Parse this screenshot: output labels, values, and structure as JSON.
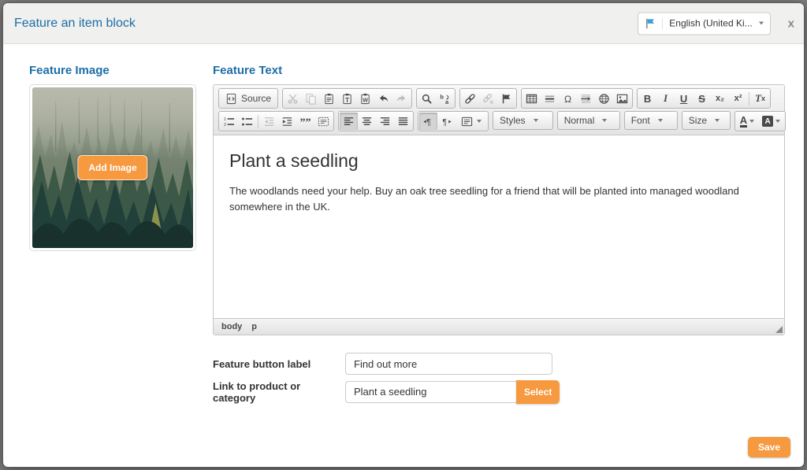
{
  "modal": {
    "title": "Feature an item block",
    "close_label": "x",
    "language": {
      "value": "English (United Ki...",
      "flag_icon": "blue-flag"
    }
  },
  "feature_image": {
    "heading": "Feature Image",
    "add_button_label": "Add Image",
    "image_description": "misty pine forest"
  },
  "feature_text": {
    "heading": "Feature Text"
  },
  "editor": {
    "toolbar": {
      "source_label": "Source",
      "styles_label": "Styles",
      "format_value": "Normal",
      "font_label": "Font",
      "size_label": "Size",
      "bold": "B",
      "italic": "I",
      "underline": "U",
      "strike": "S",
      "subscript": "x₂",
      "superscript": "x²",
      "removeformat_t": "T",
      "removeformat_x": "x",
      "text_color_letter": "A",
      "bg_color_letter": "A",
      "row1_icons": [
        "source",
        "cut",
        "copy",
        "paste",
        "paste-plain-text",
        "paste-from-word",
        "undo",
        "redo",
        "find",
        "replace",
        "link",
        "unlink",
        "anchor",
        "table",
        "horizontal-rule",
        "special-character",
        "page-break",
        "iframe",
        "image",
        "bold",
        "italic",
        "underline",
        "strikethrough",
        "subscript",
        "superscript",
        "remove-format"
      ],
      "row2_icons": [
        "numbered-list",
        "bulleted-list",
        "decrease-indent",
        "increase-indent",
        "blockquote",
        "div-container",
        "align-left",
        "align-center",
        "align-right",
        "align-justify",
        "text-direction-ltr",
        "text-direction-rtl",
        "language",
        "styles-dropdown",
        "format-dropdown",
        "font-dropdown",
        "size-dropdown",
        "text-color",
        "background-color"
      ],
      "disabled_buttons": [
        "cut",
        "copy",
        "redo",
        "unlink",
        "decrease-indent"
      ],
      "active_buttons": [
        "align-left",
        "text-direction-ltr"
      ]
    },
    "content": {
      "heading": "Plant a seedling",
      "paragraph": "The woodlands need your help. Buy an oak tree seedling for a friend that will be planted into managed woodland somewhere in the UK."
    },
    "path": [
      "body",
      "p"
    ]
  },
  "fields": {
    "button_label": {
      "label": "Feature button label",
      "value": "Find out more"
    },
    "link": {
      "label": "Link to product or category",
      "value": "Plant a seedling",
      "select_label": "Select"
    }
  },
  "footer": {
    "save_label": "Save"
  },
  "colors": {
    "accent_orange": "#f6993f",
    "heading_blue": "#1c6ea8"
  }
}
